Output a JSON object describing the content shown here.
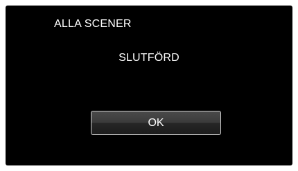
{
  "dialog": {
    "title": "ALLA SCENER",
    "message": "SLUTFÖRD",
    "ok_label": "OK"
  },
  "colors": {
    "background": "#000000",
    "text": "#ffffff",
    "button_border": "#cfcfcf"
  }
}
